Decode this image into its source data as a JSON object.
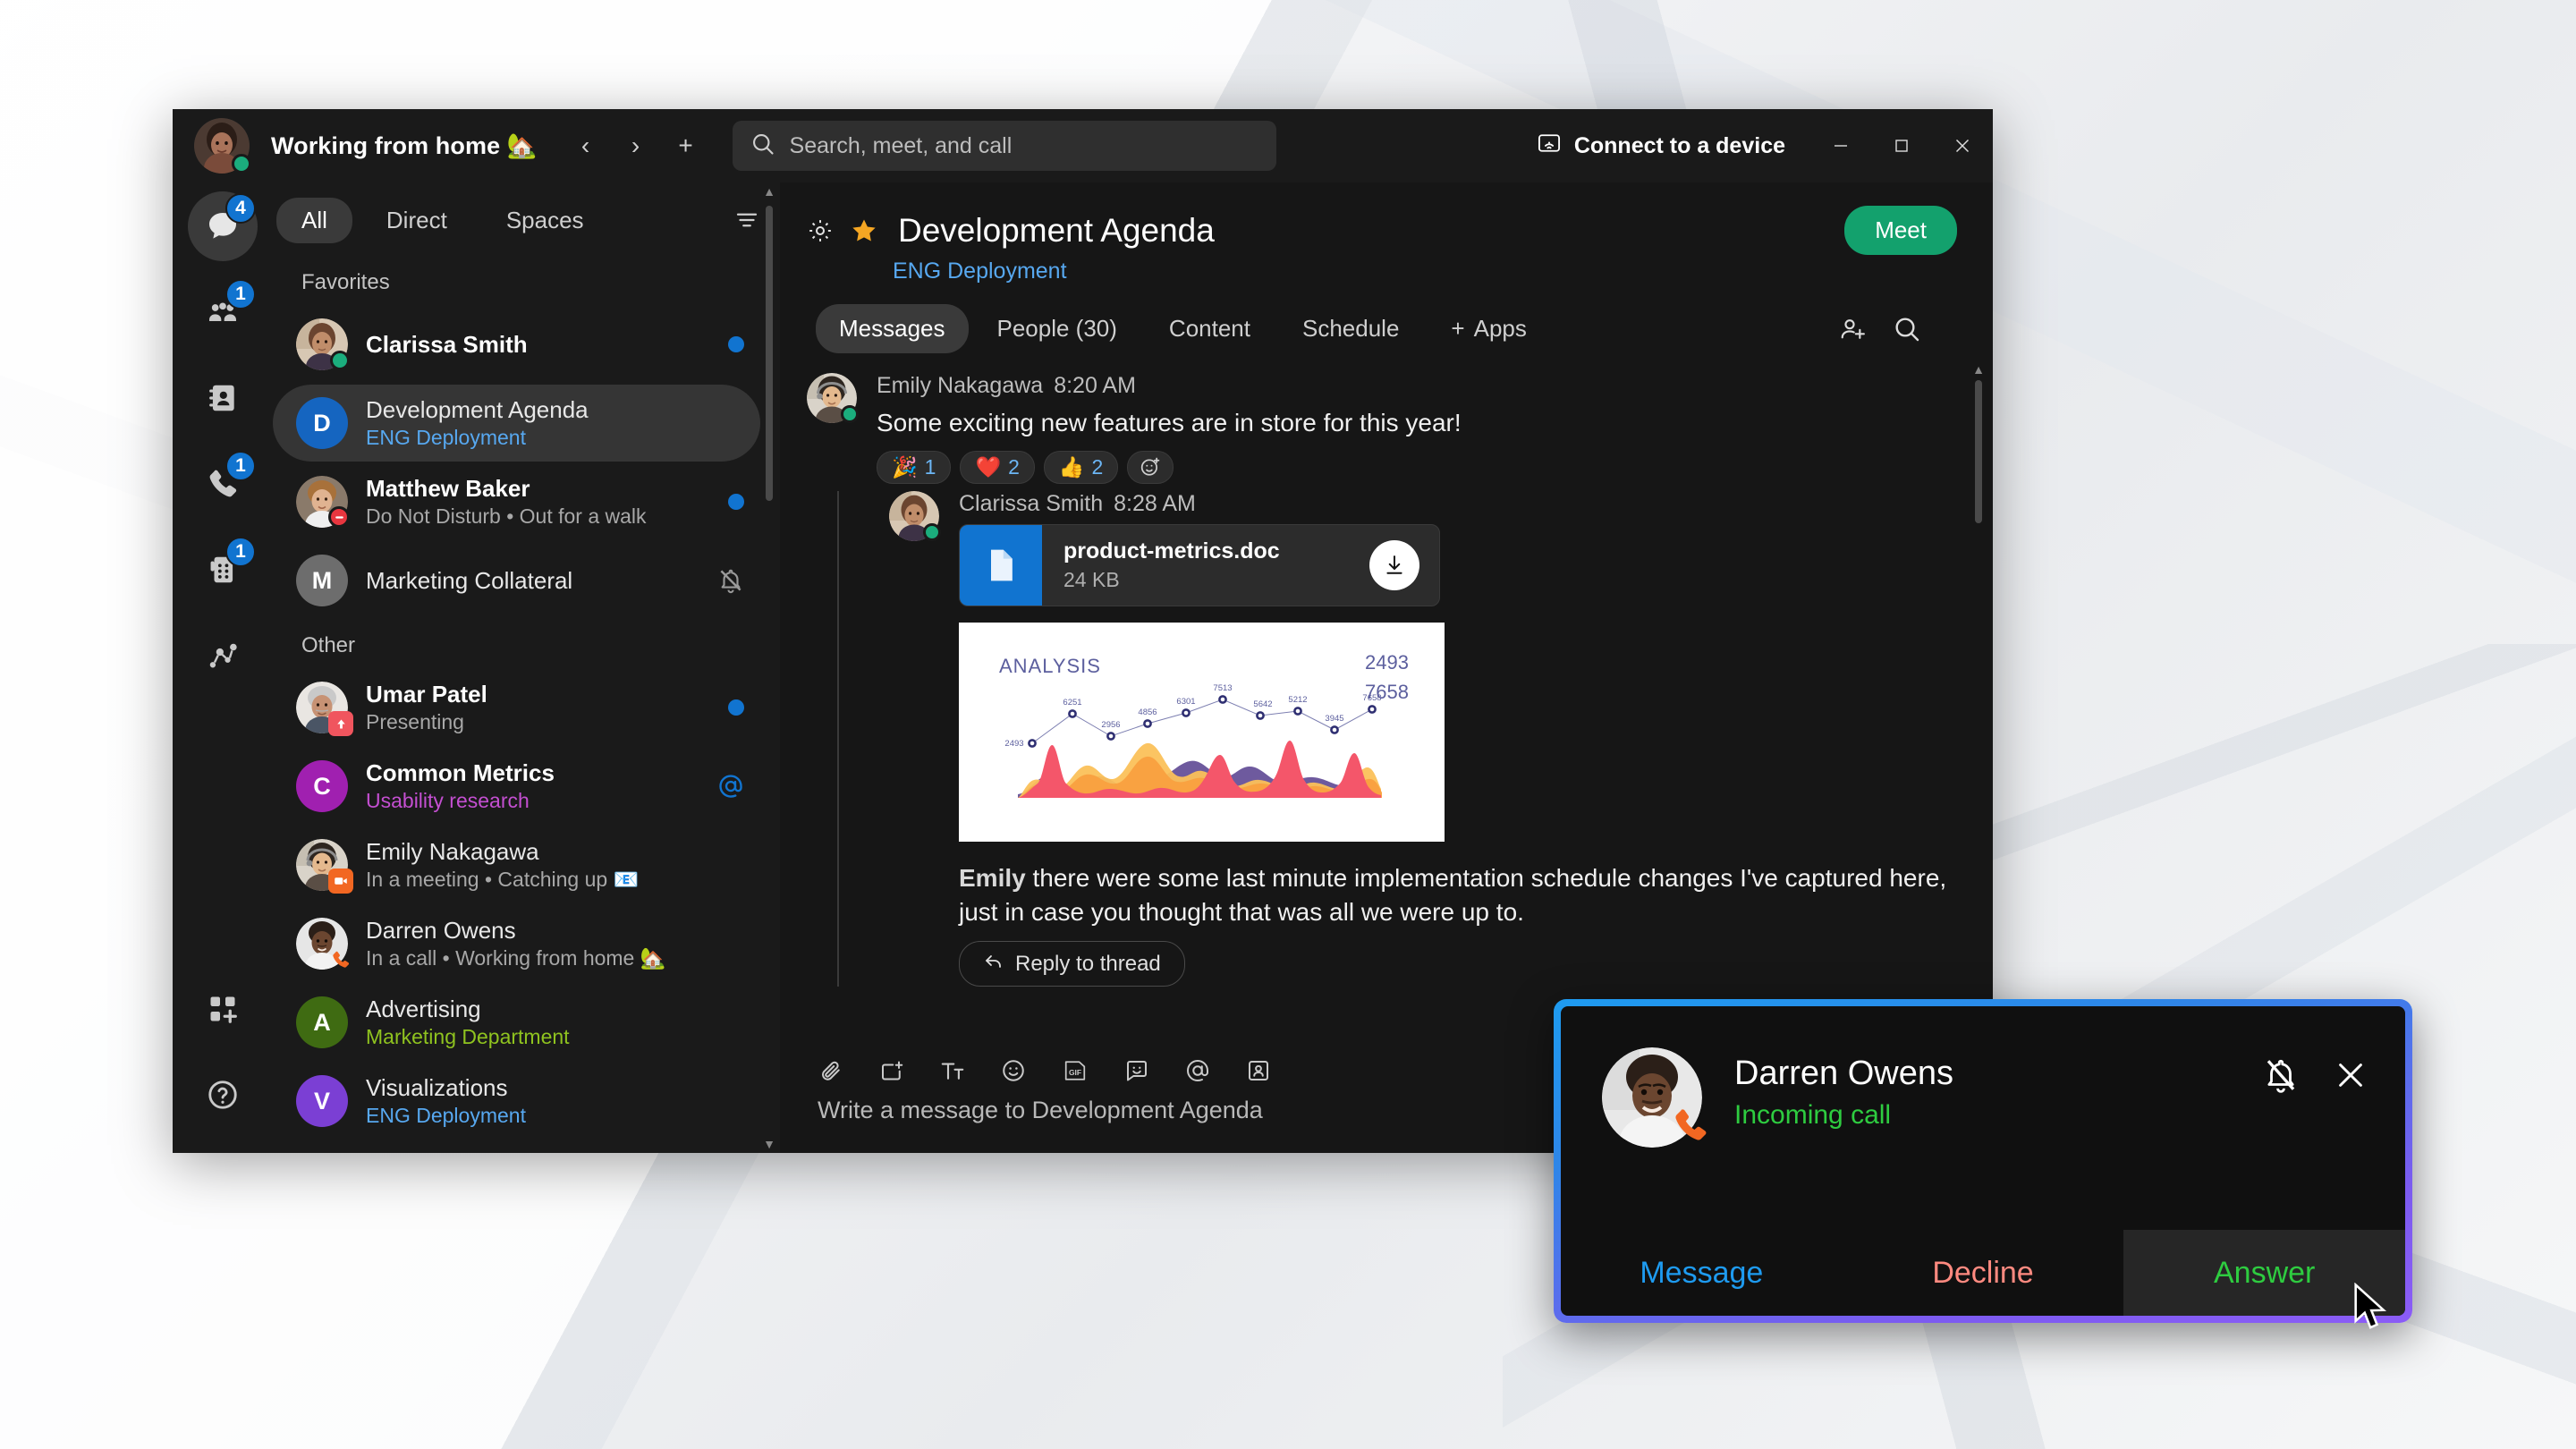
{
  "titlebar": {
    "status_text": "Working from home 🏡",
    "nav_back": "‹",
    "nav_forward": "›",
    "nav_new": "+",
    "search_placeholder": "Search, meet, and call",
    "connect_device": "Connect to a device",
    "minimize": "—",
    "maximize": "▢",
    "close": "✕"
  },
  "rail": [
    {
      "name": "messaging",
      "badge": "4",
      "icon": "chat-bubble-icon",
      "active": true
    },
    {
      "name": "teams",
      "badge": "1",
      "icon": "people-icon",
      "active": false
    },
    {
      "name": "contacts",
      "badge": "",
      "icon": "contact-card-icon",
      "active": false
    },
    {
      "name": "calling",
      "badge": "1",
      "icon": "phone-icon",
      "active": false
    },
    {
      "name": "devices",
      "badge": "1",
      "icon": "device-keypad-icon",
      "active": false
    },
    {
      "name": "insights",
      "badge": "",
      "icon": "insights-icon",
      "active": false
    }
  ],
  "rail_bottom": [
    {
      "name": "apps",
      "icon": "apps-grid-icon"
    },
    {
      "name": "help",
      "icon": "help-circle-icon"
    }
  ],
  "filters": {
    "items": [
      {
        "label": "All",
        "active": true
      },
      {
        "label": "Direct",
        "active": false
      },
      {
        "label": "Spaces",
        "active": false
      }
    ],
    "filter_icon": "filter-lines-icon"
  },
  "sections": [
    {
      "label": "Favorites",
      "items": [
        {
          "title": "Clarissa Smith",
          "sub": "",
          "sub_class": "",
          "bold": true,
          "avatar_kind": "photo",
          "photo": "clarissa",
          "presence": "available",
          "right": "unread-dot"
        },
        {
          "title": "Development Agenda",
          "sub": "ENG Deployment",
          "sub_class": "space-eng",
          "bold": false,
          "avatar_kind": "initial",
          "initial": "D",
          "color": "#1565c0",
          "right": "",
          "selected": true
        },
        {
          "title": "Matthew Baker",
          "sub": "Do Not Disturb  •  Out for a walk",
          "sub_class": "",
          "bold": true,
          "avatar_kind": "photo",
          "photo": "matthew",
          "presence": "dnd",
          "right": "unread-dot"
        },
        {
          "title": "Marketing Collateral",
          "sub": "",
          "sub_class": "",
          "bold": false,
          "avatar_kind": "initial",
          "initial": "M",
          "color": "#6d6d6d",
          "right": "mute"
        }
      ]
    },
    {
      "label": "Other",
      "items": [
        {
          "title": "Umar Patel",
          "sub": "Presenting",
          "sub_class": "",
          "bold": true,
          "avatar_kind": "photo",
          "photo": "umar",
          "badge": "presenting",
          "right": "unread-dot"
        },
        {
          "title": "Common Metrics",
          "sub": "Usability research",
          "sub_class": "space-usa",
          "bold": true,
          "avatar_kind": "initial",
          "initial": "C",
          "color": "#a020b0",
          "right": "mention"
        },
        {
          "title": "Emily Nakagawa",
          "sub": "In a meeting  •  Catching up 📧",
          "sub_class": "",
          "bold": false,
          "avatar_kind": "photo",
          "photo": "emily",
          "badge": "meeting",
          "right": ""
        },
        {
          "title": "Darren Owens",
          "sub": "In a call  •  Working from home 🏡",
          "sub_class": "",
          "bold": false,
          "avatar_kind": "photo",
          "photo": "darren",
          "badge": "incall",
          "right": ""
        },
        {
          "title": "Advertising",
          "sub": "Marketing Department",
          "sub_class": "space-mkt",
          "bold": false,
          "avatar_kind": "initial",
          "initial": "A",
          "color": "#3f6b12",
          "right": ""
        },
        {
          "title": "Visualizations",
          "sub": "ENG Deployment",
          "sub_class": "space-eng",
          "bold": false,
          "avatar_kind": "initial",
          "initial": "V",
          "color": "#7b3fd4",
          "right": ""
        }
      ]
    }
  ],
  "main": {
    "room_title": "Development Agenda",
    "space_name": "ENG Deployment",
    "meet_label": "Meet",
    "gear_icon": "gear-icon",
    "star_icon": "star-filled-icon",
    "tabs": [
      {
        "label": "Messages",
        "active": true
      },
      {
        "label": "People (30)",
        "active": false
      },
      {
        "label": "Content",
        "active": false
      },
      {
        "label": "Schedule",
        "active": false
      },
      {
        "label": "Apps",
        "active": false,
        "prefix": "+"
      }
    ],
    "tabs_right": [
      {
        "name": "people-add-icon"
      },
      {
        "name": "search-icon"
      }
    ]
  },
  "messages": [
    {
      "author": "Emily Nakagawa",
      "time": "8:20 AM",
      "text": "Some exciting new features are in store for this year!",
      "photo": "emily",
      "presence": "available",
      "reactions": [
        {
          "emoji": "🎉",
          "count": "1"
        },
        {
          "emoji": "❤️",
          "count": "2"
        },
        {
          "emoji": "👍",
          "count": "2"
        }
      ],
      "add_reaction_icon": "add-reaction-icon"
    }
  ],
  "thread": {
    "author": "Clarissa Smith",
    "time": "8:28 AM",
    "photo": "clarissa",
    "presence": "available",
    "file": {
      "name": "product-metrics.doc",
      "size": "24 KB",
      "icon": "document-icon",
      "download_icon": "download-icon"
    },
    "body_prefix": "Emily",
    "body_text": " there were some last minute implementation schedule changes I've captured here, just in case you thought that was all we were up to.",
    "reply_label": "Reply to thread",
    "reply_icon": "reply-arrow-icon"
  },
  "chart_data": {
    "type": "area",
    "title": "ANALYSIS",
    "kpis": [
      "2493",
      "7658"
    ],
    "x": [
      1,
      2,
      3,
      4,
      5,
      6,
      7,
      8,
      9,
      10
    ],
    "series": [
      {
        "name": "Trend markers",
        "values": [
          2493,
          6251,
          2956,
          4856,
          6301,
          7513,
          5642,
          5212,
          3945,
          7658
        ],
        "labels": [
          "2493",
          "6251",
          "2956",
          "4856",
          "6301",
          "7513",
          "5642",
          "5212",
          "3945",
          "7658"
        ],
        "color": "#3f3d8f"
      },
      {
        "name": "Red area",
        "color": "#f4566a"
      },
      {
        "name": "Orange area",
        "color": "#f9a03f"
      },
      {
        "name": "Yellow area",
        "color": "#fbc15a"
      },
      {
        "name": "Purple area",
        "color": "#6e5a9e"
      }
    ],
    "xlabel": "",
    "ylabel": "",
    "grid": false,
    "legend": "none"
  },
  "composer": {
    "placeholder": "Write a message to Development Agenda",
    "tools": [
      {
        "name": "attach-icon"
      },
      {
        "name": "screen-capture-icon"
      },
      {
        "name": "format-text-icon"
      },
      {
        "name": "emoji-icon"
      },
      {
        "name": "gif-icon"
      },
      {
        "name": "sticker-icon"
      },
      {
        "name": "mention-icon"
      },
      {
        "name": "person-card-icon"
      }
    ]
  },
  "call_toast": {
    "caller": "Darren Owens",
    "state": "Incoming call",
    "mute_icon": "bell-muted-icon",
    "close_icon": "close-icon",
    "buttons": [
      {
        "label": "Message",
        "kind": "message"
      },
      {
        "label": "Decline",
        "kind": "decline"
      },
      {
        "label": "Answer",
        "kind": "answer"
      }
    ]
  },
  "colors": {
    "accent_blue": "#1174d0",
    "green": "#13a16d",
    "space_blue": "#57a8f0",
    "space_green": "#8fc31f",
    "space_purple": "#c44fd1",
    "decline_red": "#ff8a80",
    "answer_green": "#2ecc40",
    "star_gold": "#f5a623"
  }
}
